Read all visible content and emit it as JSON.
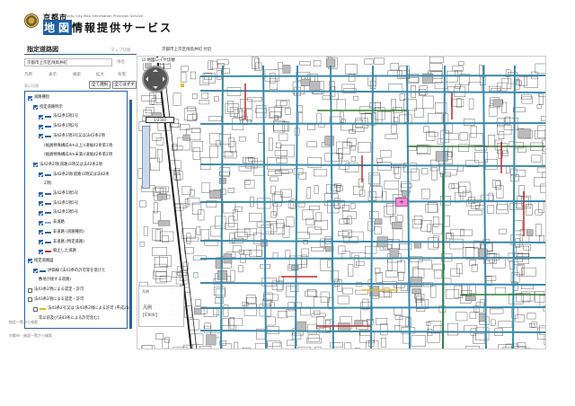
{
  "header": {
    "brand_top": "京都市",
    "brand_en": "Kyoto City Map Information Provision Service",
    "brand_main_box1": "地",
    "brand_main_box2": "図",
    "brand_main_rest": "情報提供サービス"
  },
  "sidebar": {
    "title": "指定道路図",
    "map_tab": "マップ切替",
    "address_value": "京都市上京区飛鳥井町",
    "address_button": "地名",
    "tabs": [
      "凡例",
      "表示",
      "検索",
      "拡大",
      "背景"
    ],
    "opacity_label": "表示切替",
    "select_all": "全て選択",
    "clear_all": "全てはずす",
    "layers": [
      {
        "label": "道路種別",
        "indent": 0,
        "checked": true,
        "swatch": ""
      },
      {
        "label": "指定道路明示",
        "indent": 1,
        "checked": true,
        "swatch": ""
      },
      {
        "label": "法42条1項1号",
        "indent": 2,
        "checked": true,
        "swatch": "#2a62a8"
      },
      {
        "label": "法42条1項2号",
        "indent": 2,
        "checked": true,
        "swatch": "#2a62a8"
      },
      {
        "label": "法42条1項3号又は法42条2項",
        "indent": 2,
        "checked": true,
        "swatch": "#2a62a8"
      },
      {
        "label": "(幅員特殊構成4m以上)(道幅42条第1項",
        "indent": 3,
        "checked": null,
        "swatch": ""
      },
      {
        "label": "(幅員特殊構成4m未満)(道幅42条第2項",
        "indent": 3,
        "checked": null,
        "swatch": ""
      },
      {
        "label": "法42条2項(道路)3項又は法42条2項",
        "indent": 1,
        "checked": true,
        "swatch": ""
      },
      {
        "label": "法42条2項(道路)3項又は法42条",
        "indent": 2,
        "checked": true,
        "swatch": "#2a62a8"
      },
      {
        "label": "2項)",
        "indent": 3,
        "checked": null,
        "swatch": ""
      },
      {
        "label": "法42条1項5号",
        "indent": 2,
        "checked": true,
        "swatch": "#2a62a8"
      },
      {
        "label": "法42条1項5号",
        "indent": 2,
        "checked": true,
        "swatch": "#2a62a8"
      },
      {
        "label": "法42条1項5号",
        "indent": 2,
        "checked": true,
        "swatch": "#2a62a8"
      },
      {
        "label": "非道路",
        "indent": 2,
        "checked": true,
        "swatch": "#9aa8b8"
      },
      {
        "label": "非道路 (道路種別)",
        "indent": 2,
        "checked": true,
        "swatch": "#2a62a8"
      },
      {
        "label": "非道路 (特定道路)",
        "indent": 2,
        "checked": true,
        "swatch": "#2a62a8"
      },
      {
        "label": "廃止した道路",
        "indent": 2,
        "checked": true,
        "swatch": "#c62828"
      },
      {
        "label": "指定道路図",
        "indent": 0,
        "checked": true,
        "swatch": ""
      },
      {
        "label": "評価線 (法43条の許可等を受けた",
        "indent": 1,
        "checked": true,
        "swatch": "#2a62a8"
      },
      {
        "label": "敷地が接する道路)",
        "indent": 2,
        "checked": null,
        "swatch": ""
      },
      {
        "label": "法43条2項による認定・許可",
        "indent": 0,
        "checked": false,
        "swatch": ""
      },
      {
        "label": "法43条2項による認定・許可",
        "indent": 0,
        "checked": false,
        "swatch": ""
      },
      {
        "label": "法43条2号又は 法43条2項による許可 (平成28",
        "indent": 1,
        "checked": false,
        "swatch": "#e9b825"
      },
      {
        "label": "年以前及び法43条による許可含む)",
        "indent": 2,
        "checked": null,
        "swatch": ""
      }
    ],
    "link1": "指定一覧から検索",
    "link2": "京都市・施設一覧から検索"
  },
  "map": {
    "top_label": "京都市上京区飛鳥井町 付近",
    "layer_toggle": "地図レイヤ切替",
    "scale_text": "1/2500",
    "legend_title": "凡例",
    "legend_heading": "凡例",
    "legend_click": "[Click]",
    "marker_symbol": "+"
  },
  "colors": {
    "accent": "#2a62a8",
    "road_blue": "#3d8aa9",
    "road_red": "#c62828",
    "road_green": "#2e7d32",
    "road_yellow": "#e9b825",
    "marker": "#f08bd3"
  }
}
